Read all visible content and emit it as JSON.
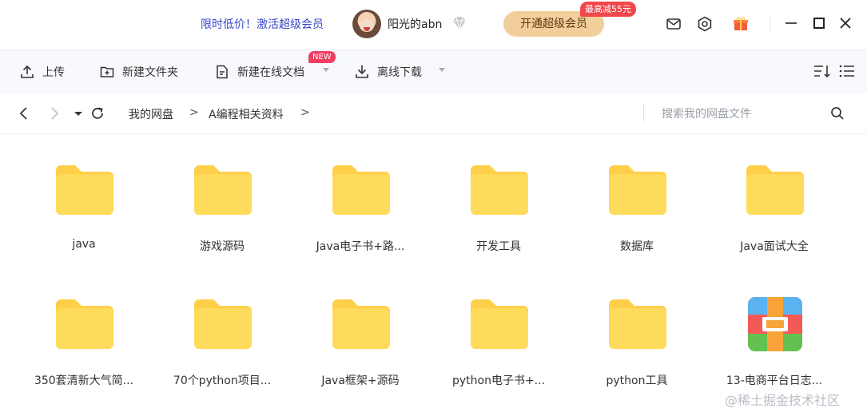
{
  "header": {
    "promo_text": "限时低价！激活超级会员",
    "username": "阳光的abn",
    "vip_button": "开通超级会员",
    "vip_badge": "最高减55元",
    "colors": {
      "promo": "#3a47c8",
      "vip_button_bg": "#f2cf9a",
      "badge_bg": "#f0474d"
    }
  },
  "toolbar": {
    "upload": "上传",
    "new_folder": "新建文件夹",
    "new_online_doc": "新建在线文档",
    "new_badge": "NEW",
    "offline_download": "离线下载"
  },
  "nav": {
    "breadcrumb": [
      "我的网盘",
      "A编程相关资料"
    ],
    "separator": ">",
    "search_placeholder": "搜索我的网盘文件"
  },
  "files": [
    {
      "name": "java",
      "type": "folder"
    },
    {
      "name": "游戏源码",
      "type": "folder"
    },
    {
      "name": "Java电子书+路...",
      "type": "folder"
    },
    {
      "name": "开发工具",
      "type": "folder"
    },
    {
      "name": "数据库",
      "type": "folder"
    },
    {
      "name": "Java面试大全",
      "type": "folder"
    },
    {
      "name": "350套清新大气简...",
      "type": "folder"
    },
    {
      "name": "70个python项目...",
      "type": "folder"
    },
    {
      "name": "Java框架+源码",
      "type": "folder"
    },
    {
      "name": "python电子书+...",
      "type": "folder"
    },
    {
      "name": "python工具",
      "type": "folder"
    },
    {
      "name": "13-电商平台日志...",
      "type": "archive"
    }
  ],
  "watermark": "@稀土掘金技术社区",
  "folder_color": "#ffd65a"
}
